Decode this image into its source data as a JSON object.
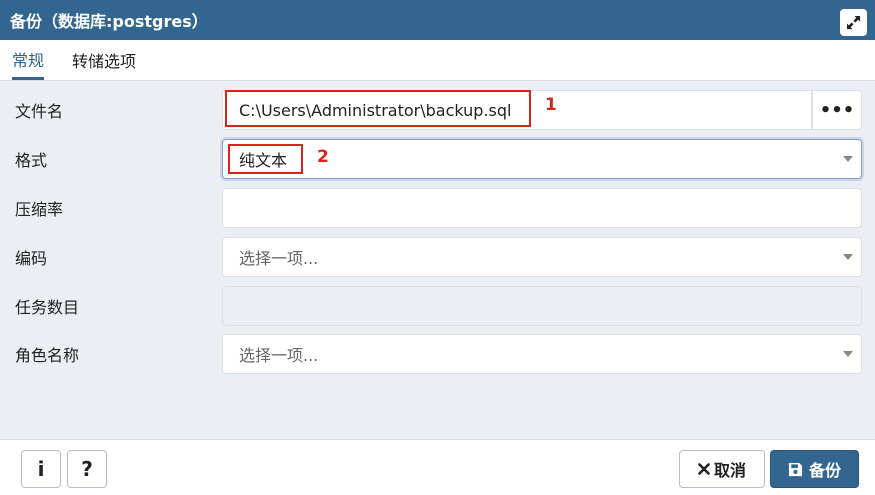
{
  "dialog": {
    "title": "备份（数据库:postgres）",
    "expand_icon": "expand-arrows-icon"
  },
  "tabs": [
    {
      "label": "常规",
      "active": true
    },
    {
      "label": "转储选项",
      "active": false
    }
  ],
  "form": {
    "filename": {
      "label": "文件名",
      "value": "C:\\Users\\Administrator\\backup.sql",
      "browse_label": "•••"
    },
    "format": {
      "label": "格式",
      "value": "纯文本"
    },
    "compression": {
      "label": "压缩率",
      "value": ""
    },
    "encoding": {
      "label": "编码",
      "placeholder": "选择一项..."
    },
    "jobs": {
      "label": "任务数目",
      "value": ""
    },
    "role": {
      "label": "角色名称",
      "placeholder": "选择一项..."
    }
  },
  "annotations": {
    "marker1": "1",
    "marker2": "2",
    "color": "#e0201e"
  },
  "footer": {
    "info_label": "i",
    "help_label": "?",
    "cancel_label": "取消",
    "backup_label": "备份"
  },
  "colors": {
    "brand": "#326690",
    "background": "#ebeef3"
  }
}
